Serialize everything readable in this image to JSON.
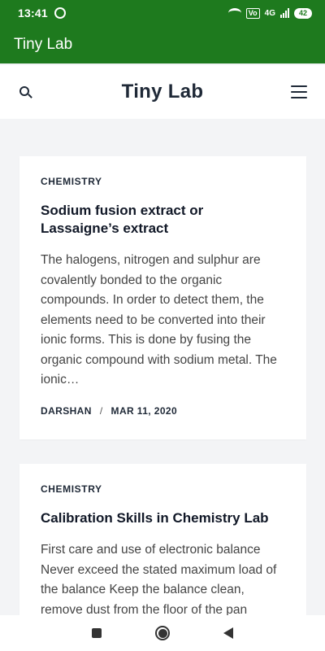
{
  "status_bar": {
    "time": "13:41",
    "volte": "Vo",
    "network": "4G",
    "battery": "42"
  },
  "app_bar": {
    "title": "Tiny Lab"
  },
  "site_header": {
    "title": "Tiny Lab"
  },
  "articles": [
    {
      "category": "CHEMISTRY",
      "title": "Sodium fusion extract or Lassaigne’s extract",
      "excerpt": "The halogens, nitrogen and sulphur are covalently bonded to the organic compounds. In order to detect them, the elements need to be converted into their ionic forms. This is done by fusing the organic compound with sodium metal. The ionic…",
      "author": "DARSHAN",
      "separator": "/",
      "date": "MAR 11, 2020"
    },
    {
      "category": "CHEMISTRY",
      "title": "Calibration Skills in Chemistry Lab",
      "excerpt": "First care and use of electronic balance Never exceed the stated maximum load of the balance Keep the balance clean, remove dust from the floor of the pan"
    }
  ],
  "colors": {
    "app_bar": "#1e7a1e",
    "page_bg": "#f3f4f6"
  }
}
